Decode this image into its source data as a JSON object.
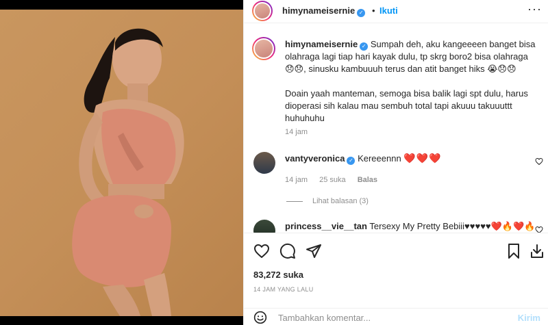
{
  "header": {
    "username": "himynameisernie",
    "dot": "•",
    "follow_label": "Ikuti",
    "more_label": "···"
  },
  "caption": {
    "username": "himynameisernie",
    "paragraph1": "Sumpah deh, aku kangeeeen banget bisa olahraga lagi tiap hari kayak dulu, tp skrg boro2 bisa olahraga 😞😞, sinusku kambuuuh terus dan atit banget hiks 😭😞😞",
    "paragraph2": "Doain yaah manteman, semoga bisa balik lagi spt dulu, harus dioperasi sih kalau mau sembuh total tapi akuuu takuuuttt huhuhuhu",
    "time": "14 jam"
  },
  "comments": [
    {
      "username": "vantyveronica",
      "text": "Kereeennn",
      "emoji": "❤️❤️❤️",
      "time": "14 jam",
      "likes": "25 suka",
      "reply_label": "Balas",
      "view_replies": "Lihat balasan (3)"
    },
    {
      "username": "princess__vie__tan",
      "text": "Tersexy My Pretty Bebiii♥♥♥♥♥❤️🔥❤️🔥"
    }
  ],
  "actions": {
    "likes": "83,272 suka",
    "ago": "14 JAM YANG LALU"
  },
  "composer": {
    "placeholder": "Tambahkan komentar...",
    "post_label": "Kirim"
  },
  "colors": {
    "accent": "#0095f6",
    "post_disabled": "#b2dffc",
    "heart": "#ed4956",
    "verified": "#3897f0",
    "photo_background": "#c48f58",
    "outfit": "#d98a72"
  },
  "icons": [
    "verified-icon",
    "more-icon",
    "heart-icon",
    "comment-icon",
    "share-icon",
    "bookmark-icon",
    "download-icon",
    "emoji-icon"
  ]
}
